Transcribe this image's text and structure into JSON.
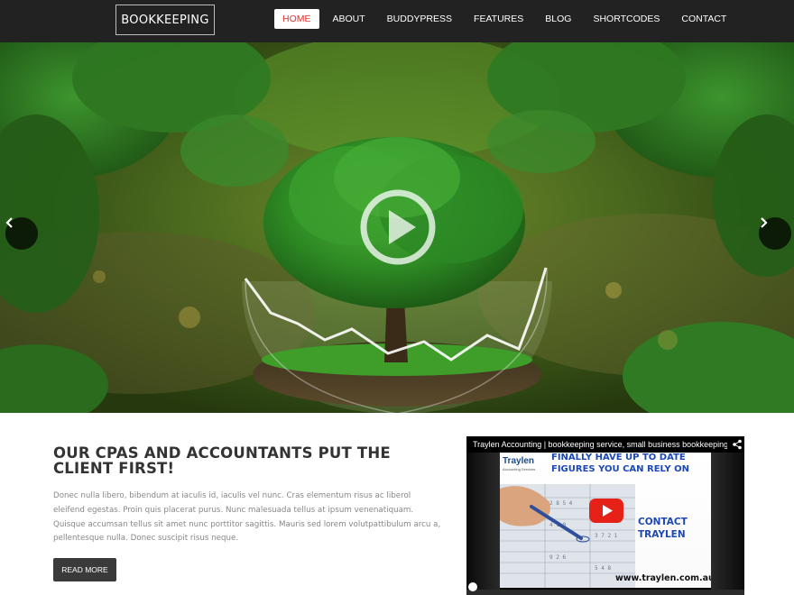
{
  "site": {
    "logo": "BOOKKEEPING"
  },
  "nav": {
    "items": [
      {
        "label": "HOME",
        "active": true
      },
      {
        "label": "ABOUT",
        "active": false
      },
      {
        "label": "BUDDYPRESS",
        "active": false
      },
      {
        "label": "FEATURES",
        "active": false
      },
      {
        "label": "BLOG",
        "active": false
      },
      {
        "label": "SHORTCODES",
        "active": false
      },
      {
        "label": "CONTACT",
        "active": false
      }
    ]
  },
  "hero": {
    "prev_icon": "chevron-left-icon",
    "next_icon": "chevron-right-icon",
    "play_icon": "play-circle-icon"
  },
  "content": {
    "heading": "OUR CPAS AND ACCOUNTANTS PUT THE CLIENT FIRST!",
    "body": "Donec nulla libero, bibendum at iaculis id, iaculis vel nunc. Cras elementum risus ac liberol eleifend egestas. Proin quis placerat purus. Nunc malesuada tellus at ipsum venenatiquam. Quisque accumsan tellus sit amet nunc porttitor sagittis. Mauris sed lorem volutpattibulum arcu a, pellentesque nulla. Donec suscipit risus neque.",
    "button": "READ MORE"
  },
  "video": {
    "title": "Traylen Accounting | bookkeeping service, small business bookkeeping...",
    "thumb_logo": "Traylen",
    "thumb_logo_sub": "Accounting Services",
    "thumb_headline": "FINALLY HAVE UP TO DATE FIGURES YOU CAN RELY ON",
    "thumb_contact_line1": "CONTACT",
    "thumb_contact_line2": "TRAYLEN",
    "thumb_url": "www.traylen.com.au",
    "progress": 0.0
  },
  "colors": {
    "header_bg": "#222222",
    "accent": "#e0312b",
    "button_bg": "#3a3a3a",
    "youtube_red": "#e62117"
  }
}
